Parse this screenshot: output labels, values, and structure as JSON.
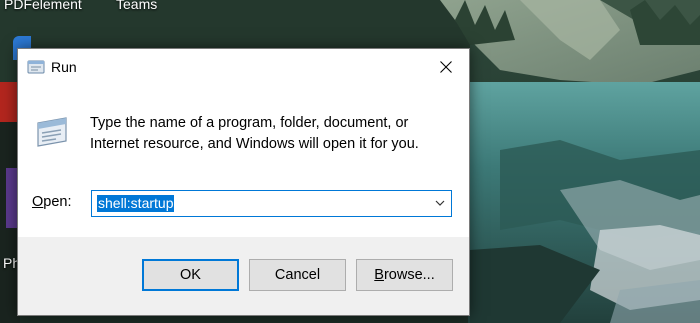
{
  "desktop": {
    "labels": [
      "PDFelement",
      "Teams",
      "Ph"
    ]
  },
  "dialog": {
    "title": "Run",
    "description": "Type the name of a program, folder, document, or Internet resource, and Windows will open it for you.",
    "open_label_mnemonic": "O",
    "open_label_rest": "pen:",
    "open_value": "shell:startup",
    "buttons": {
      "ok": "OK",
      "cancel": "Cancel",
      "browse_mnemonic": "B",
      "browse_rest": "rowse..."
    }
  },
  "colors": {
    "accent": "#0078d7",
    "dialog_bg": "#f0f0f0",
    "button_bg": "#e1e1e1"
  },
  "icons": [
    "run-app-icon",
    "close-icon",
    "chevron-down-icon",
    "run-large-icon"
  ]
}
